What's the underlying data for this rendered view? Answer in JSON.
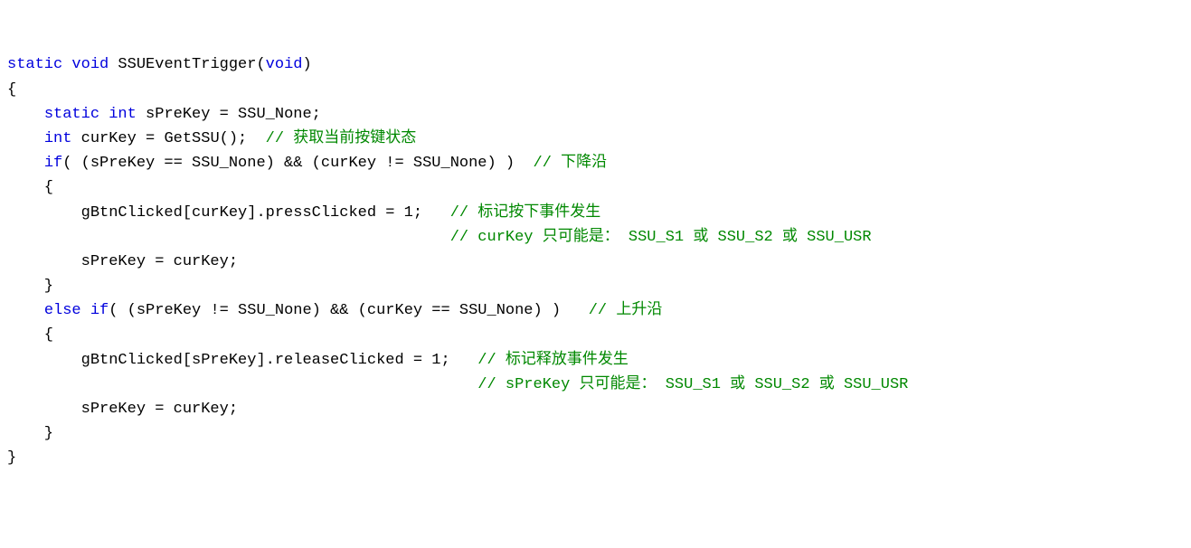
{
  "code": {
    "l1_kw1": "static",
    "l1_kw2": "void",
    "l1_fn": " SSUEventTrigger(",
    "l1_kw3": "void",
    "l1_close": ")",
    "l2": "{",
    "l3_pad": "    ",
    "l3_kw1": "static",
    "l3_sp1": " ",
    "l3_kw2": "int",
    "l3_rest": " sPreKey = SSU_None;",
    "l4": "",
    "l5_pad": "    ",
    "l5_kw": "int",
    "l5_rest": " curKey = GetSSU();  ",
    "l5_cm": "// 获取当前按键状态",
    "l6": "",
    "l7_pad": "    ",
    "l7_kw": "if",
    "l7_rest": "( (sPreKey == SSU_None) && (curKey != SSU_None) )  ",
    "l7_cm": "// 下降沿",
    "l8": "    {",
    "l9_code": "        gBtnClicked[curKey].pressClicked = 1;   ",
    "l9_cm": "// 标记按下事件发生",
    "l10_pad": "                                                ",
    "l10_cm": "// curKey 只可能是： SSU_S1 或 SSU_S2 或 SSU_USR",
    "l11": "        sPreKey = curKey;",
    "l12": "    }",
    "l13_pad": "    ",
    "l13_kw1": "else",
    "l13_sp": " ",
    "l13_kw2": "if",
    "l13_rest": "( (sPreKey != SSU_None) && (curKey == SSU_None) )   ",
    "l13_cm": "// 上升沿",
    "l14": "    {",
    "l15_code": "        gBtnClicked[sPreKey].releaseClicked = 1;   ",
    "l15_cm": "// 标记释放事件发生",
    "l16_pad": "                                                   ",
    "l16_cm": "// sPreKey 只可能是： SSU_S1 或 SSU_S2 或 SSU_USR",
    "l17": "        sPreKey = curKey;",
    "l18": "    }",
    "l19": "}"
  }
}
